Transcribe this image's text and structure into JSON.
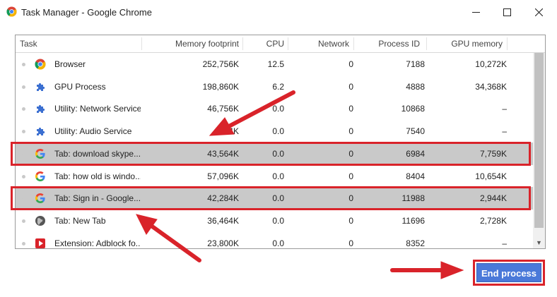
{
  "window": {
    "title": "Task Manager - Google Chrome"
  },
  "columns": {
    "task": "Task",
    "memory": "Memory footprint",
    "cpu": "CPU",
    "network": "Network",
    "pid": "Process ID",
    "gpu": "GPU memory"
  },
  "rows": [
    {
      "task": "Browser",
      "icon": "chrome-icon",
      "memory": "252,756K",
      "cpu": "12.5",
      "network": "0",
      "pid": "7188",
      "gpu": "10,272K"
    },
    {
      "task": "GPU Process",
      "icon": "puzzle-icon",
      "memory": "198,860K",
      "cpu": "6.2",
      "network": "0",
      "pid": "4888",
      "gpu": "34,368K"
    },
    {
      "task": "Utility: Network Service",
      "icon": "puzzle-icon",
      "memory": "46,756K",
      "cpu": "0.0",
      "network": "0",
      "pid": "10868",
      "gpu": "–"
    },
    {
      "task": "Utility: Audio Service",
      "icon": "puzzle-icon",
      "memory": "...44K",
      "cpu": "0.0",
      "network": "0",
      "pid": "7540",
      "gpu": "–"
    },
    {
      "task": "Tab: download skype...",
      "icon": "google-icon",
      "memory": "43,564K",
      "cpu": "0.0",
      "network": "0",
      "pid": "6984",
      "gpu": "7,759K",
      "selected": true
    },
    {
      "task": "Tab: how old is windo...",
      "icon": "google-icon",
      "memory": "57,096K",
      "cpu": "0.0",
      "network": "0",
      "pid": "8404",
      "gpu": "10,654K"
    },
    {
      "task": "Tab: Sign in - Google...",
      "icon": "google-icon",
      "memory": "42,284K",
      "cpu": "0.0",
      "network": "0",
      "pid": "11988",
      "gpu": "2,944K",
      "selected": true
    },
    {
      "task": "Tab: New Tab",
      "icon": "globe-icon",
      "memory": "36,464K",
      "cpu": "0.0",
      "network": "0",
      "pid": "11696",
      "gpu": "2,728K"
    },
    {
      "task": "Extension: Adblock fo...",
      "icon": "extension-icon",
      "memory": "23,800K",
      "cpu": "0.0",
      "network": "0",
      "pid": "8352",
      "gpu": "–"
    }
  ],
  "actions": {
    "end_process": "End process"
  },
  "colors": {
    "accent": "#4a79d9",
    "highlight": "#d9232a",
    "selected_row": "#c9c9c9"
  }
}
